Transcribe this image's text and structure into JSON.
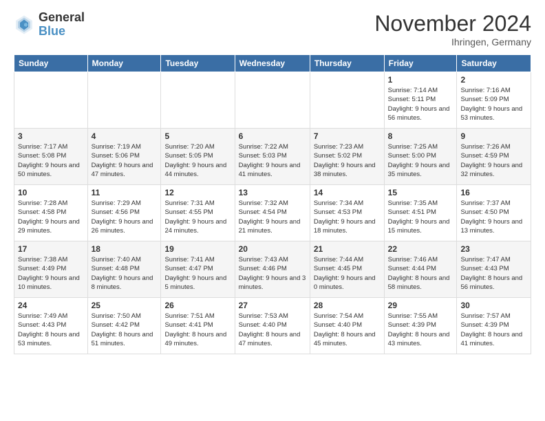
{
  "header": {
    "logo_line1": "General",
    "logo_line2": "Blue",
    "month": "November 2024",
    "location": "Ihringen, Germany"
  },
  "weekdays": [
    "Sunday",
    "Monday",
    "Tuesday",
    "Wednesday",
    "Thursday",
    "Friday",
    "Saturday"
  ],
  "weeks": [
    [
      {
        "day": "",
        "info": ""
      },
      {
        "day": "",
        "info": ""
      },
      {
        "day": "",
        "info": ""
      },
      {
        "day": "",
        "info": ""
      },
      {
        "day": "",
        "info": ""
      },
      {
        "day": "1",
        "info": "Sunrise: 7:14 AM\nSunset: 5:11 PM\nDaylight: 9 hours and 56 minutes."
      },
      {
        "day": "2",
        "info": "Sunrise: 7:16 AM\nSunset: 5:09 PM\nDaylight: 9 hours and 53 minutes."
      }
    ],
    [
      {
        "day": "3",
        "info": "Sunrise: 7:17 AM\nSunset: 5:08 PM\nDaylight: 9 hours and 50 minutes."
      },
      {
        "day": "4",
        "info": "Sunrise: 7:19 AM\nSunset: 5:06 PM\nDaylight: 9 hours and 47 minutes."
      },
      {
        "day": "5",
        "info": "Sunrise: 7:20 AM\nSunset: 5:05 PM\nDaylight: 9 hours and 44 minutes."
      },
      {
        "day": "6",
        "info": "Sunrise: 7:22 AM\nSunset: 5:03 PM\nDaylight: 9 hours and 41 minutes."
      },
      {
        "day": "7",
        "info": "Sunrise: 7:23 AM\nSunset: 5:02 PM\nDaylight: 9 hours and 38 minutes."
      },
      {
        "day": "8",
        "info": "Sunrise: 7:25 AM\nSunset: 5:00 PM\nDaylight: 9 hours and 35 minutes."
      },
      {
        "day": "9",
        "info": "Sunrise: 7:26 AM\nSunset: 4:59 PM\nDaylight: 9 hours and 32 minutes."
      }
    ],
    [
      {
        "day": "10",
        "info": "Sunrise: 7:28 AM\nSunset: 4:58 PM\nDaylight: 9 hours and 29 minutes."
      },
      {
        "day": "11",
        "info": "Sunrise: 7:29 AM\nSunset: 4:56 PM\nDaylight: 9 hours and 26 minutes."
      },
      {
        "day": "12",
        "info": "Sunrise: 7:31 AM\nSunset: 4:55 PM\nDaylight: 9 hours and 24 minutes."
      },
      {
        "day": "13",
        "info": "Sunrise: 7:32 AM\nSunset: 4:54 PM\nDaylight: 9 hours and 21 minutes."
      },
      {
        "day": "14",
        "info": "Sunrise: 7:34 AM\nSunset: 4:53 PM\nDaylight: 9 hours and 18 minutes."
      },
      {
        "day": "15",
        "info": "Sunrise: 7:35 AM\nSunset: 4:51 PM\nDaylight: 9 hours and 15 minutes."
      },
      {
        "day": "16",
        "info": "Sunrise: 7:37 AM\nSunset: 4:50 PM\nDaylight: 9 hours and 13 minutes."
      }
    ],
    [
      {
        "day": "17",
        "info": "Sunrise: 7:38 AM\nSunset: 4:49 PM\nDaylight: 9 hours and 10 minutes."
      },
      {
        "day": "18",
        "info": "Sunrise: 7:40 AM\nSunset: 4:48 PM\nDaylight: 9 hours and 8 minutes."
      },
      {
        "day": "19",
        "info": "Sunrise: 7:41 AM\nSunset: 4:47 PM\nDaylight: 9 hours and 5 minutes."
      },
      {
        "day": "20",
        "info": "Sunrise: 7:43 AM\nSunset: 4:46 PM\nDaylight: 9 hours and 3 minutes."
      },
      {
        "day": "21",
        "info": "Sunrise: 7:44 AM\nSunset: 4:45 PM\nDaylight: 9 hours and 0 minutes."
      },
      {
        "day": "22",
        "info": "Sunrise: 7:46 AM\nSunset: 4:44 PM\nDaylight: 8 hours and 58 minutes."
      },
      {
        "day": "23",
        "info": "Sunrise: 7:47 AM\nSunset: 4:43 PM\nDaylight: 8 hours and 56 minutes."
      }
    ],
    [
      {
        "day": "24",
        "info": "Sunrise: 7:49 AM\nSunset: 4:43 PM\nDaylight: 8 hours and 53 minutes."
      },
      {
        "day": "25",
        "info": "Sunrise: 7:50 AM\nSunset: 4:42 PM\nDaylight: 8 hours and 51 minutes."
      },
      {
        "day": "26",
        "info": "Sunrise: 7:51 AM\nSunset: 4:41 PM\nDaylight: 8 hours and 49 minutes."
      },
      {
        "day": "27",
        "info": "Sunrise: 7:53 AM\nSunset: 4:40 PM\nDaylight: 8 hours and 47 minutes."
      },
      {
        "day": "28",
        "info": "Sunrise: 7:54 AM\nSunset: 4:40 PM\nDaylight: 8 hours and 45 minutes."
      },
      {
        "day": "29",
        "info": "Sunrise: 7:55 AM\nSunset: 4:39 PM\nDaylight: 8 hours and 43 minutes."
      },
      {
        "day": "30",
        "info": "Sunrise: 7:57 AM\nSunset: 4:39 PM\nDaylight: 8 hours and 41 minutes."
      }
    ]
  ]
}
